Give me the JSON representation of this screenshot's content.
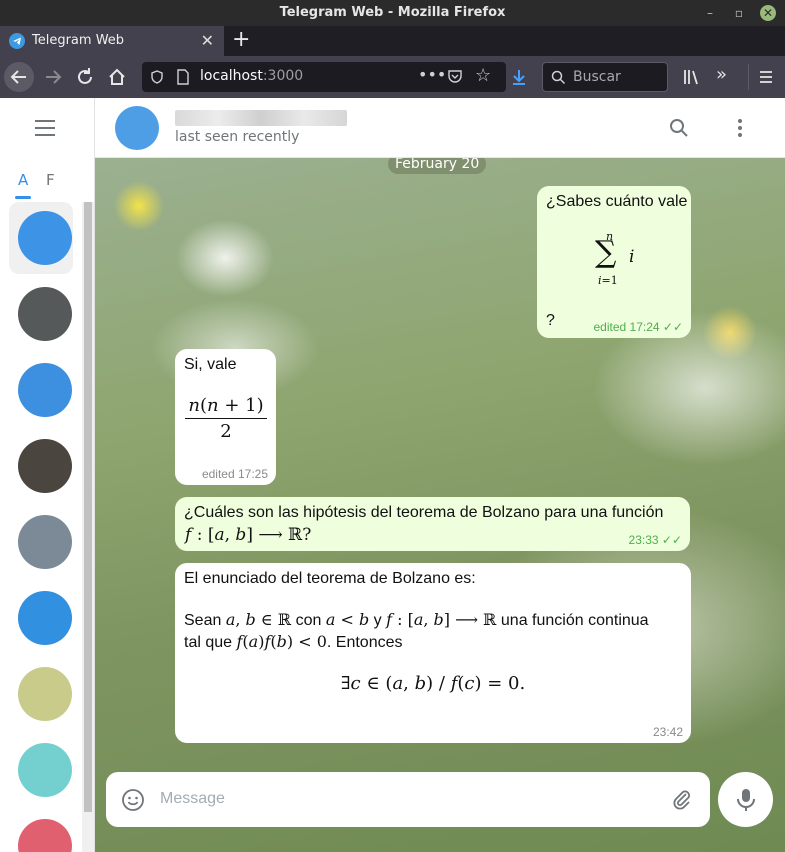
{
  "window": {
    "title": "Telegram Web - Mozilla Firefox"
  },
  "browser": {
    "tab_label": "Telegram Web",
    "url_host": "localhost",
    "url_port": ":3000",
    "search_placeholder": "Buscar"
  },
  "sidebar": {
    "folders": [
      "A",
      "F"
    ],
    "chats": [
      {
        "color": "#3d94e6"
      },
      {
        "color": "#55595a"
      },
      {
        "color": "#3d8fe0"
      },
      {
        "color": "#4b4540"
      },
      {
        "color": "#7c8a98"
      },
      {
        "color": "#3190df"
      },
      {
        "color": "#c8cb8a"
      },
      {
        "color": "#74cfcf"
      },
      {
        "color": "#e06070"
      }
    ]
  },
  "chat": {
    "status": "last seen recently",
    "date_label": "February 20",
    "composer_placeholder": "Message"
  },
  "messages": {
    "m1": {
      "text": "¿Sabes cuánto vale",
      "qmark": "?",
      "time": "edited 17:24"
    },
    "m2": {
      "text": "Si, vale",
      "time": "edited 17:25"
    },
    "m3": {
      "text_a": "¿Cuáles son las hipótesis del teorema de Bolzano para una función",
      "time": "23:33"
    },
    "m4": {
      "line1": "El enunciado del teorema de Bolzano es:",
      "sean": "Sean",
      "con": "con",
      "y": "y",
      "cont": "una función continua",
      "tal_que": "tal que",
      "entonces": ". Entonces",
      "time": "23:42"
    }
  },
  "colors": {
    "accent": "#3390ec",
    "outgoing_bubble": "#effedd",
    "read_check": "#4fae4e"
  }
}
